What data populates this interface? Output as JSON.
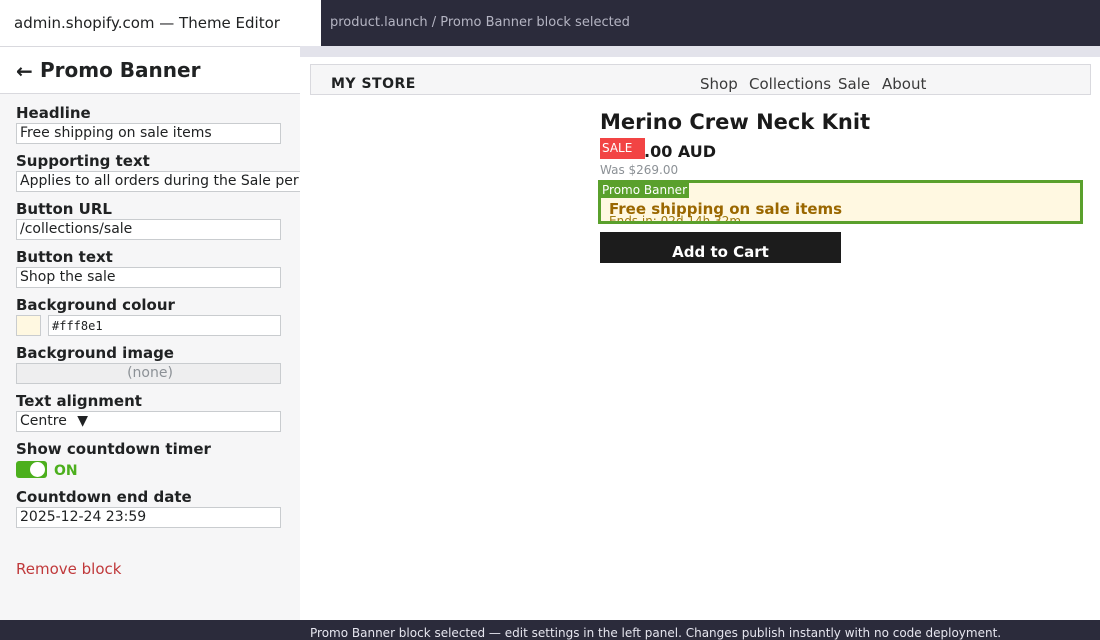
{
  "window": {
    "app_title": "admin.shopify.com — Theme Editor",
    "context_status": "product.launch / Promo Banner block selected"
  },
  "sidebar": {
    "back_icon": "←",
    "title": "Promo Banner",
    "fields": {
      "headline": {
        "label": "Headline",
        "value": "Free shipping on sale items"
      },
      "supporting_text": {
        "label": "Supporting text",
        "value": "Applies to all orders during the Sale per"
      },
      "button_url": {
        "label": "Button URL",
        "value": "/collections/sale"
      },
      "button_text": {
        "label": "Button text",
        "value": "Shop the sale"
      },
      "background_colour": {
        "label": "Background colour",
        "value": "#fff8e1"
      },
      "background_image": {
        "label": "Background image",
        "value": "(none)"
      },
      "text_alignment": {
        "label": "Text alignment",
        "value": "Centre",
        "arrow": "▼"
      },
      "countdown_toggle": {
        "label": "Show countdown timer",
        "state": "ON",
        "on": true
      },
      "countdown_end": {
        "label": "Countdown end date",
        "value": "2025-12-24 23:59"
      }
    },
    "remove_label": "Remove block"
  },
  "preview": {
    "store_name": "MY STORE",
    "nav": [
      "Shop",
      "Collections",
      "Sale",
      "About"
    ],
    "product": {
      "title": "Merino Crew Neck Knit",
      "badge": "SALE",
      "price": ".00 AUD",
      "was_price": "Was $269.00",
      "add_to_cart": "Add to Cart"
    },
    "promo": {
      "tag": "Promo Banner",
      "headline": "Free shipping on sale items",
      "countdown": "Ends in: 02d 14h 32m"
    }
  },
  "status_bar": {
    "text": "Promo Banner block selected — edit settings in the left panel. Changes publish instantly with no code deployment."
  },
  "colors": {
    "selection_outline": "#5aa02c",
    "promo_background": "#fff8e1",
    "toggle_on": "#4caf1d",
    "sale_badge": "#f24444",
    "danger": "#c0393b",
    "chrome_dark": "#2b2b3b"
  }
}
